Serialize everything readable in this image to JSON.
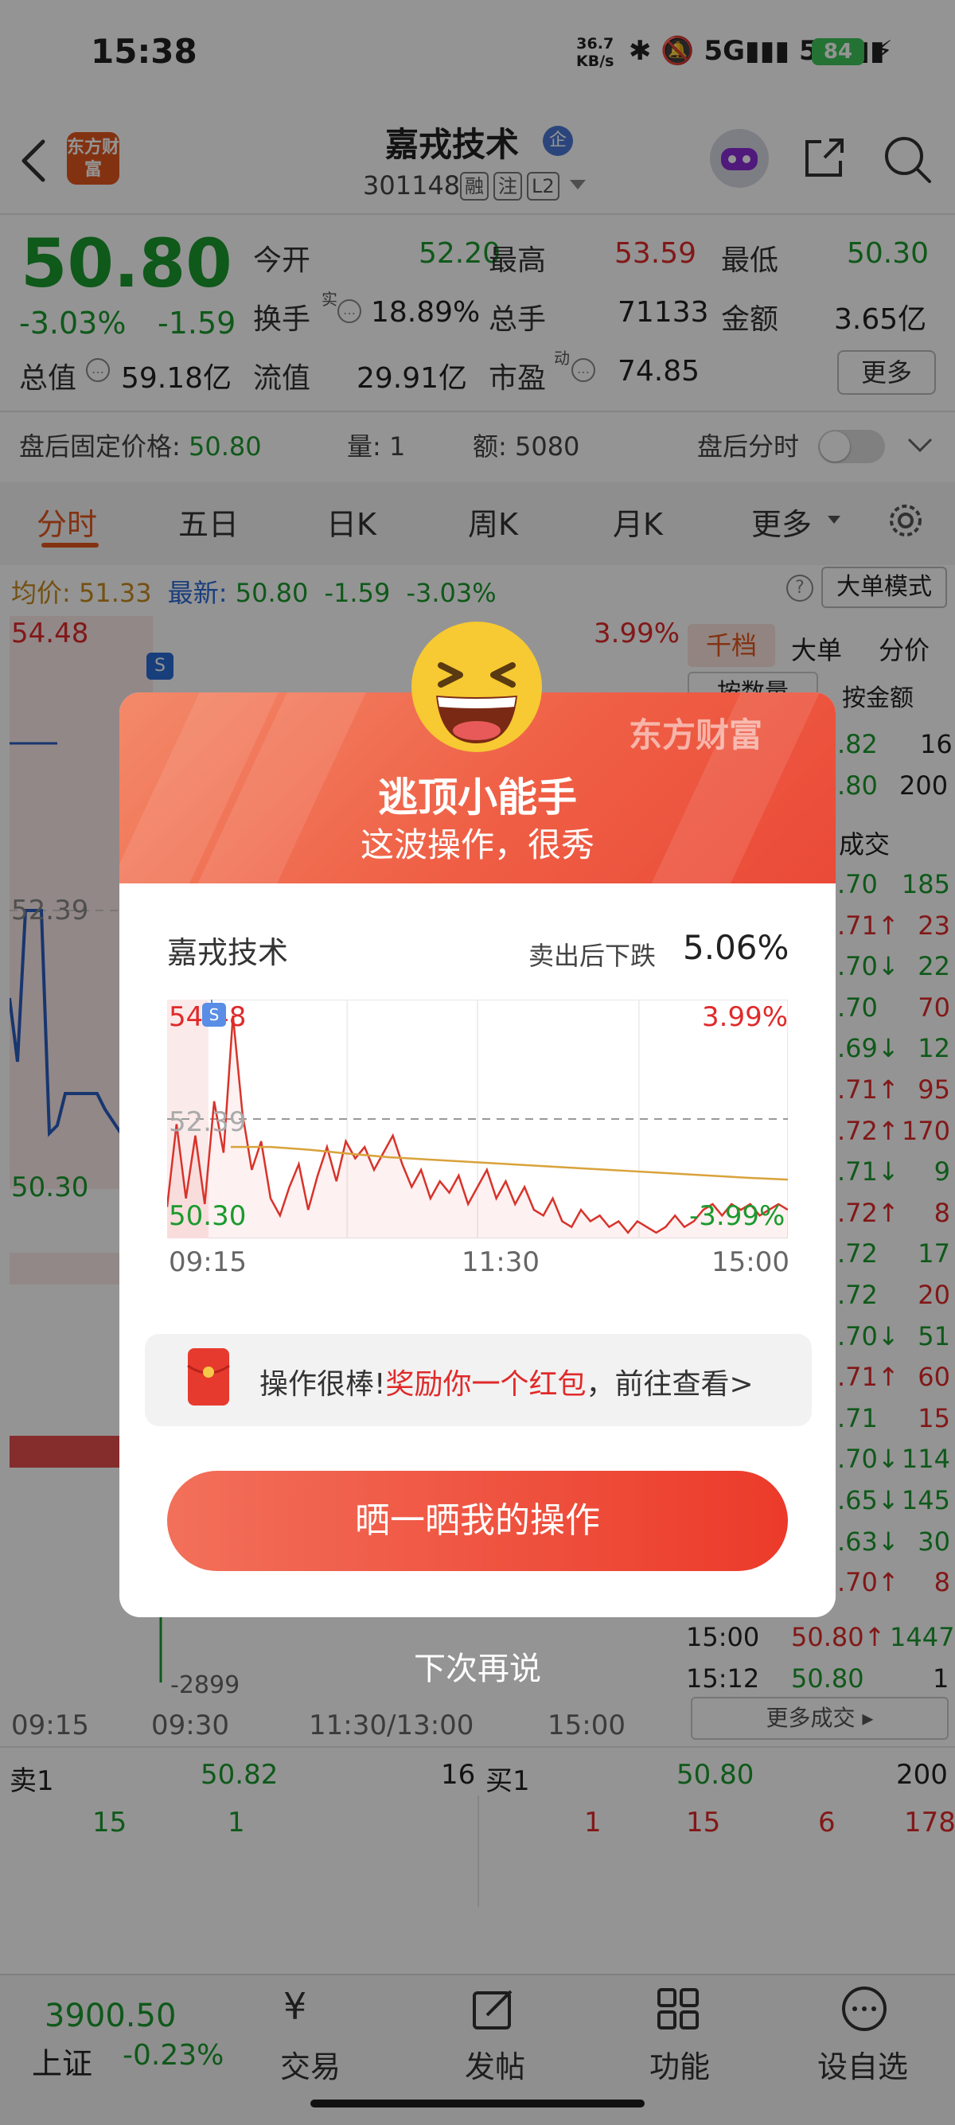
{
  "status_bar": {
    "time": "15:38",
    "speed_top": "36.7",
    "speed_bottom": "KB/s",
    "icons_text": "✱ 🔕 5G▮▮▮ 5G▮▮▮",
    "battery": "84"
  },
  "header": {
    "logo": "东方财富",
    "stock_name": "嘉戎技术",
    "qi_badge": "企",
    "stock_code": "301148",
    "tags": [
      "融",
      "注",
      "L2"
    ]
  },
  "quote": {
    "price": "50.80",
    "change_pct": "-3.03%",
    "change": "-1.59",
    "rows": [
      [
        {
          "l": "今开",
          "v": "52.20",
          "c": "green"
        },
        {
          "l": "最高",
          "v": "53.59",
          "c": "red"
        },
        {
          "l": "最低",
          "v": "50.30",
          "c": "green"
        }
      ],
      [
        {
          "l": "换手",
          "v": "18.89%",
          "c": "gray"
        },
        {
          "l": "总手",
          "v": "71133",
          "c": "gray"
        },
        {
          "l": "金额",
          "v": "3.65亿",
          "c": "gray"
        }
      ]
    ],
    "row3": [
      {
        "l": "总值",
        "v": "59.18亿"
      },
      {
        "l": "流值",
        "v": "29.91亿"
      },
      {
        "l": "市盈",
        "v": "74.85"
      }
    ],
    "shi_sup": "实",
    "dong_sup": "动",
    "more": "更多",
    "after_label": "盘后固定价格:",
    "after_price": "50.80",
    "after_vol_label": "量:",
    "after_vol": "1",
    "after_amt_label": "额:",
    "after_amt": "5080",
    "after_timeshare": "盘后分时"
  },
  "tabs": [
    "分时",
    "五日",
    "日K",
    "周K",
    "月K",
    "更多"
  ],
  "info": {
    "avg_label": "均价:",
    "avg": "51.33",
    "latest_label": "最新:",
    "latest": "50.80",
    "chg": "-1.59",
    "chg_pct": "-3.03%",
    "big_order": "大单模式"
  },
  "chart_bg": {
    "top": "54.48",
    "mid": "52.39",
    "bottom": "50.30",
    "pct_top": "3.99%",
    "vol_label": "-2899",
    "times": [
      "09:15",
      "09:30",
      "11:30/13:00",
      "15:00"
    ],
    "s_marker": "S"
  },
  "right_panel": {
    "tabs": [
      "千档",
      "大单",
      "分价"
    ],
    "subtabs": [
      "按数量",
      "按金额"
    ],
    "top_rows": [
      [
        "",
        ".82",
        "16"
      ],
      [
        "",
        ".80",
        "200"
      ]
    ],
    "trade_label": "成交",
    "rows": [
      [
        ".70",
        "185",
        "green"
      ],
      [
        ".71↑",
        "23",
        "red"
      ],
      [
        ".70↓",
        "22",
        "green"
      ],
      [
        ".70",
        "70",
        "red"
      ],
      [
        ".69↓",
        "12",
        "green"
      ],
      [
        ".71↑",
        "95",
        "red"
      ],
      [
        ".72↑",
        "170",
        "red"
      ],
      [
        ".71↓",
        "9",
        "green"
      ],
      [
        ".72↑",
        "8",
        "red"
      ],
      [
        ".72",
        "17",
        "green"
      ],
      [
        ".72",
        "20",
        "red"
      ],
      [
        ".70↓",
        "51",
        "green"
      ],
      [
        ".71↑",
        "60",
        "red"
      ],
      [
        ".71",
        "15",
        "red"
      ],
      [
        ".70↓",
        "114",
        "green"
      ],
      [
        ".65↓",
        "145",
        "green"
      ],
      [
        ".63↓",
        "30",
        "green"
      ],
      [
        ".70↑",
        "8",
        "red"
      ]
    ],
    "last_rows": [
      [
        "15:00",
        "50.80↑",
        "1447"
      ],
      [
        "15:12",
        "50.80",
        "1"
      ]
    ],
    "more_trades": "更多成交 ▸"
  },
  "order_book": {
    "sell_label": "卖1",
    "sell_price": "50.82",
    "sell_vol": "16",
    "buy_label": "买1",
    "buy_price": "50.80",
    "buy_vol": "200",
    "sell_queue": [
      "15",
      "1"
    ],
    "buy_queue": [
      "1",
      "15",
      "6",
      "178"
    ]
  },
  "bottom_bar": {
    "index_value": "3900.50",
    "index_name": "上证",
    "index_chg": "-0.23%",
    "items": [
      "交易",
      "发帖",
      "功能",
      "设自选"
    ]
  },
  "modal": {
    "brand": "东方财富",
    "title": "逃顶小能手",
    "subtitle": "这波操作，很秀",
    "stock_name": "嘉戎技术",
    "drop_label": "卖出后下跌",
    "drop_value": "5.06%",
    "reward_text_a": "操作很棒!",
    "reward_text_b": "奖励你一个红包",
    "reward_text_c": "，前往查看>",
    "share_button": "晒一晒我的操作",
    "next_time": "下次再说"
  },
  "chart_data": {
    "type": "line",
    "y_left_labels": [
      "54.48",
      "52.39",
      "50.30"
    ],
    "y_right_labels": [
      "3.99%",
      "-3.99%"
    ],
    "ylim": [
      50.3,
      54.48
    ],
    "x_labels": [
      "09:15",
      "11:30",
      "15:00"
    ],
    "marker": "S",
    "series": [
      {
        "name": "price",
        "values": [
          50.85,
          52.3,
          51.0,
          52.1,
          50.9,
          52.7,
          51.8,
          54.2,
          52.5,
          51.5,
          52.0,
          51.0,
          50.7,
          51.2,
          51.6,
          50.8,
          51.4,
          51.9,
          51.3,
          52.0,
          51.7,
          51.9,
          51.5,
          51.8,
          52.1,
          51.6,
          51.2,
          51.5,
          51.0,
          51.3,
          51.1,
          51.4,
          50.9,
          51.2,
          51.5,
          51.0,
          51.3,
          50.9,
          51.2,
          50.8,
          50.7,
          51.0,
          50.6,
          50.5,
          50.8,
          50.6,
          50.7,
          50.5,
          50.6,
          50.4,
          50.6,
          50.5,
          50.4,
          50.5,
          50.7,
          50.5,
          50.6,
          50.8,
          50.9,
          50.7,
          50.9,
          50.8,
          50.9,
          50.7,
          50.8,
          50.9,
          50.8
        ]
      },
      {
        "name": "avg",
        "values": [
          51.9,
          51.9,
          51.85,
          51.78,
          51.72,
          51.68,
          51.64,
          51.6,
          51.56,
          51.52,
          51.48,
          51.44,
          51.4,
          51.36,
          51.33
        ]
      }
    ]
  }
}
